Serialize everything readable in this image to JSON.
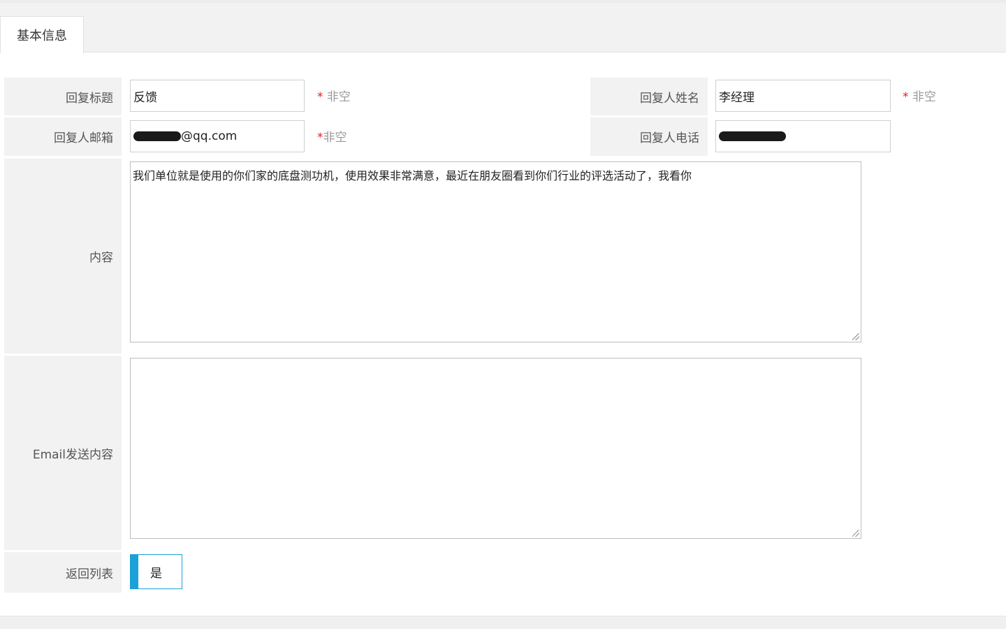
{
  "tabs": [
    {
      "label": "基本信息",
      "active": true
    }
  ],
  "form": {
    "reply_title": {
      "label": "回复标题",
      "value": "反馈",
      "hint_star": "*",
      "hint": " 非空"
    },
    "reply_name": {
      "label": "回复人姓名",
      "value": "李经理",
      "hint_star": "*",
      "hint": " 非空"
    },
    "reply_email": {
      "label": "回复人邮箱",
      "value_suffix": "@qq.com",
      "hint_star": "*",
      "hint": "非空"
    },
    "reply_phone": {
      "label": "回复人电话"
    },
    "content": {
      "label": "内容",
      "value": "我们单位就是使用的你们家的底盘测功机，使用效果非常满意，最近在朋友圈看到你们行业的评选活动了，我看你"
    },
    "email_content": {
      "label": "Email发送内容",
      "value": ""
    },
    "return_list": {
      "label": "返回列表",
      "value": "是"
    }
  },
  "colors": {
    "accent": "#1ca0d8",
    "required": "#e02020",
    "label_bg": "#f2f2f2"
  }
}
